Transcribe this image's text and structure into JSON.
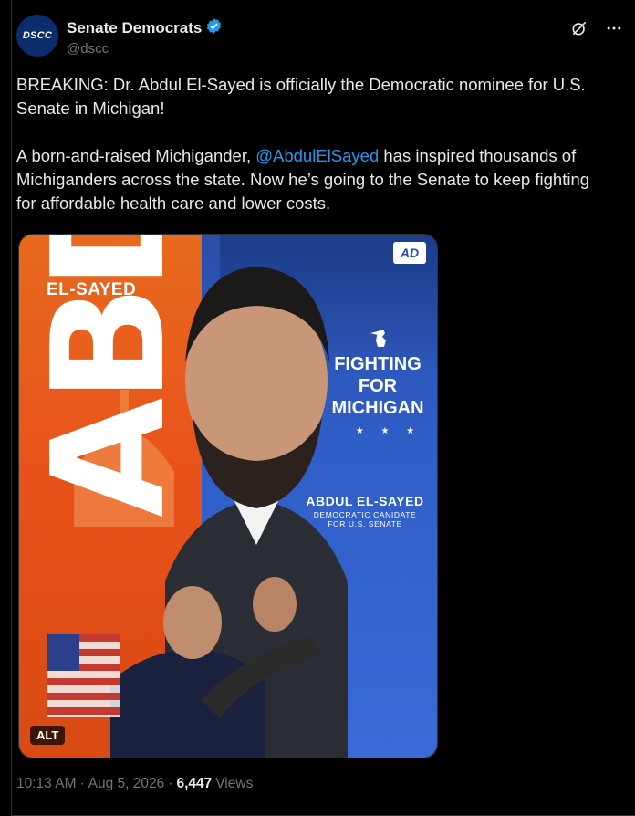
{
  "account": {
    "display_name": "Senate Democrats",
    "handle": "@dscc",
    "avatar_text": "DSCC",
    "verified_icon": "verified-badge-icon"
  },
  "header_actions": {
    "grok_icon": "grok-icon",
    "more_icon": "more-icon"
  },
  "tweet": {
    "paragraph1": "BREAKING: Dr. Abdul El-Sayed is officially the Democratic nominee for U.S. Senate in Michigan!",
    "paragraph2_before": "A born-and-raised Michigander, ",
    "mention": "@AbdulElSayed",
    "paragraph2_after": " has inspired thousands of Michiganders across the state. Now he’s going to the Senate to keep fighting for affordable health care and lower costs."
  },
  "media": {
    "big_text": "ABDUL",
    "el_sayed_label": "EL-SAYED",
    "logo_text": "AD",
    "fighting_line1": "FIGHTING",
    "fighting_line2": "FOR",
    "fighting_line3": "MICHIGAN",
    "stars": "★ ★ ★",
    "nominee_name": "ABDUL EL-SAYED",
    "nominee_title_line1": "DEMOCRATIC CANIDATE",
    "nominee_title_line2": "FOR U.S. SENATE",
    "alt_label": "ALT"
  },
  "meta": {
    "time": "10:13 AM",
    "separator": "·",
    "date": "Aug 5, 2026",
    "views_count": "6,447",
    "views_label": "Views"
  },
  "colors": {
    "link": "#1d9bf0",
    "verified": "#1d9bf0",
    "muted": "#71767b",
    "poster_orange": "#e8521a",
    "poster_blue": "#2f5ec8"
  }
}
